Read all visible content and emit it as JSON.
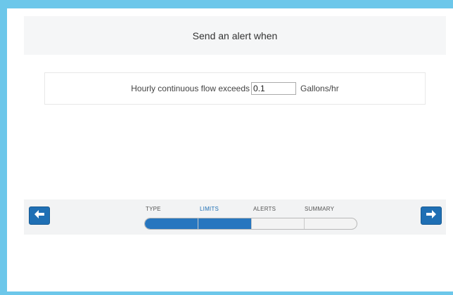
{
  "header": {
    "title": "Send an alert when"
  },
  "rule": {
    "label": "Hourly continuous flow exceeds",
    "value": "0.1",
    "unit": "Gallons/hr"
  },
  "wizard": {
    "steps": [
      {
        "label": "TYPE",
        "active": false
      },
      {
        "label": "LIMITS",
        "active": true
      },
      {
        "label": "ALERTS",
        "active": false
      },
      {
        "label": "SUMMARY",
        "active": false
      }
    ],
    "progress_fraction": 0.5,
    "back_icon": "arrow-left-icon",
    "next_icon": "arrow-right-icon"
  },
  "colors": {
    "accent": "#1f6fb4",
    "frame": "#6cc7ea",
    "header_bg": "#f5f6f7"
  }
}
